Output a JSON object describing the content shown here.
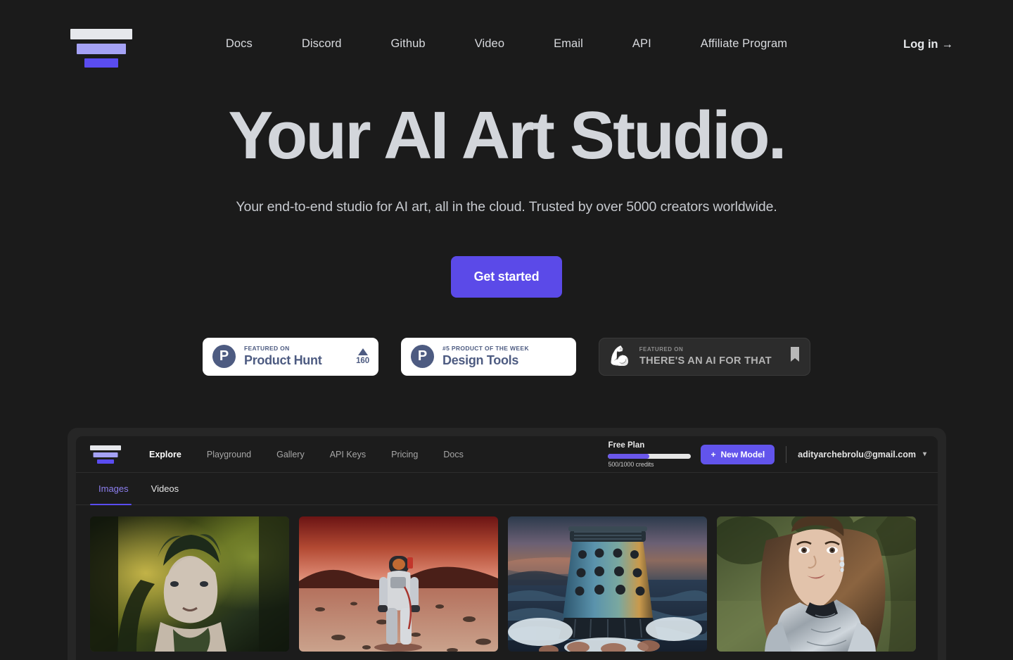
{
  "brand": {
    "logo_name": "brand-logo"
  },
  "nav": {
    "links": [
      {
        "label": "Docs"
      },
      {
        "label": "Discord"
      },
      {
        "label": "Github"
      },
      {
        "label": "Video"
      },
      {
        "label": "Email"
      },
      {
        "label": "API"
      },
      {
        "label": "Affiliate Program"
      }
    ],
    "login_label": "Log in",
    "login_arrow": "→"
  },
  "hero": {
    "title": "Your AI Art Studio.",
    "subtitle": "Your end-to-end studio for AI art, all in the cloud. Trusted by over 5000 creators worldwide.",
    "cta_label": "Get started",
    "cta_color": "#5b4ae8",
    "title_color": "#d3d6db"
  },
  "badges": [
    {
      "type": "product-hunt",
      "logo_letter": "P",
      "kicker": "FEATURED ON",
      "name": "Product Hunt",
      "votes": "160",
      "accent": "#4d5b81",
      "background": "#ffffff"
    },
    {
      "type": "product-hunt",
      "logo_letter": "P",
      "kicker": "#5 PRODUCT OF THE WEEK",
      "name": "Design Tools",
      "accent": "#4d5b81",
      "background": "#ffffff"
    },
    {
      "type": "theres-an-ai-for-that",
      "icon": "flexed-biceps",
      "kicker": "FEATURED ON",
      "name": "THERE'S AN AI FOR THAT",
      "accent": "#b3b3b3",
      "background": "#2c2c2c"
    }
  ],
  "app_preview": {
    "nav_links": [
      {
        "label": "Explore",
        "active": true
      },
      {
        "label": "Playground",
        "active": false
      },
      {
        "label": "Gallery",
        "active": false
      },
      {
        "label": "API Keys",
        "active": false
      },
      {
        "label": "Pricing",
        "active": false
      },
      {
        "label": "Docs",
        "active": false
      }
    ],
    "plan": {
      "title": "Free Plan",
      "credits": "500/1000 credits",
      "progress_percent": 50,
      "bar_color": "#6a57ea"
    },
    "new_model_label": "New Model",
    "new_model_icon": "plus-icon",
    "account_email": "adityarchebrolu@gmail.com",
    "tabs": [
      {
        "label": "Images",
        "active": true
      },
      {
        "label": "Videos",
        "active": false
      }
    ],
    "gallery": [
      {
        "alt": "Forest nymph woman with leafy crown in golden mossy woods"
      },
      {
        "alt": "Astronaut walking on Mars under a deep red sky"
      },
      {
        "alt": "Blue riveted Dalek-like machine rising from stormy ocean at dusk"
      },
      {
        "alt": "Portrait of a woman in polished silver armor in a green park"
      }
    ]
  }
}
